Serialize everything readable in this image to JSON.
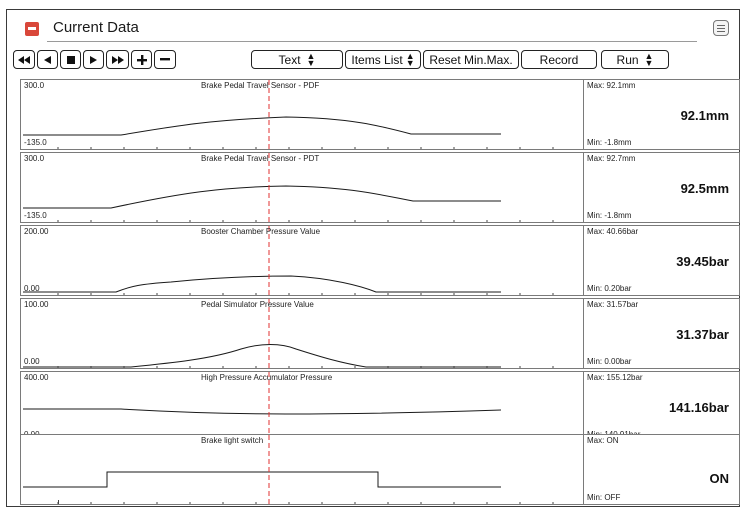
{
  "window": {
    "title": "Current Data"
  },
  "toolbar": {
    "display_mode": "Text",
    "items_list_label": "Items List",
    "reset_label": "Reset Min.Max.",
    "record_label": "Record",
    "run_label": "Run"
  },
  "panels": [
    {
      "name": "Brake Pedal Travel Sensor - PDF",
      "scale_max": "300.0",
      "scale_min": "-135.0",
      "max_label": "Max: 92.1mm",
      "min_label": "Min: -1.8mm",
      "value": "92.1mm"
    },
    {
      "name": "Brake Pedal Travel Sensor - PDT",
      "scale_max": "300.0",
      "scale_min": "-135.0",
      "max_label": "Max: 92.7mm",
      "min_label": "Min: -1.8mm",
      "value": "92.5mm"
    },
    {
      "name": "Booster Chamber Pressure Value",
      "scale_max": "200.00",
      "scale_min": "0.00",
      "max_label": "Max: 40.66bar",
      "min_label": "Min: 0.20bar",
      "value": "39.45bar"
    },
    {
      "name": "Pedal Simulator Pressure Value",
      "scale_max": "100.00",
      "scale_min": "0.00",
      "max_label": "Max: 31.57bar",
      "min_label": "Min: 0.00bar",
      "value": "31.37bar"
    },
    {
      "name": "High Pressure Accumulator Pressure",
      "scale_max": "400.00",
      "scale_min": "0.00",
      "max_label": "Max: 155.12bar",
      "min_label": "Min: 140.91bar",
      "value": "141.16bar"
    },
    {
      "name": "Brake light switch",
      "scale_max": "",
      "scale_min": "",
      "max_label": "Max: ON",
      "min_label": "Min: OFF",
      "value": "ON"
    }
  ],
  "colors": {
    "title_icon": "#d9473a",
    "cursor_line": "#e03030",
    "trace": "#1a1a1a"
  },
  "icons": [
    "collapse-icon",
    "menu-icon",
    "rewind-icon",
    "step-back-icon",
    "stop-icon",
    "play-icon",
    "fast-forward-icon",
    "plus-icon",
    "minus-icon"
  ]
}
